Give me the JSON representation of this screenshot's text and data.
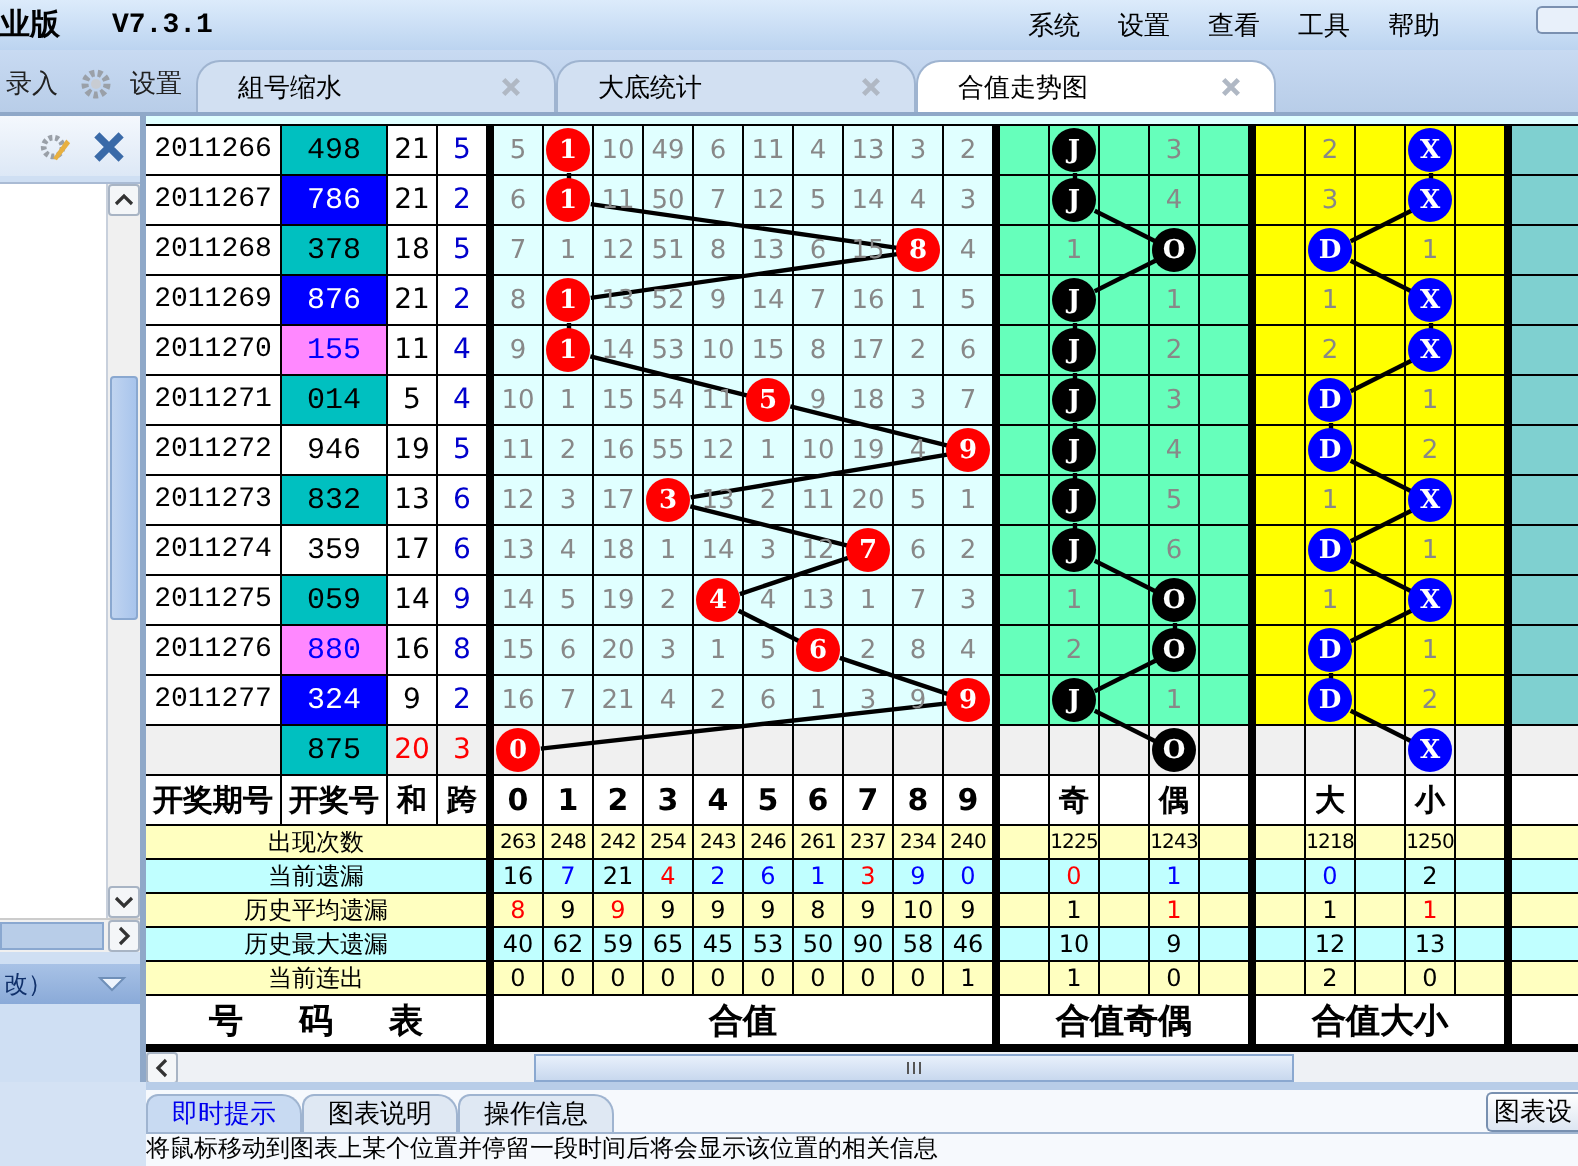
{
  "title_bar": {
    "title": "业版",
    "version": "V7.3.1",
    "menu": [
      "系统",
      "设置",
      "查看",
      "工具",
      "帮助"
    ]
  },
  "toolbar": [
    {
      "label": "录入",
      "kind": "text"
    },
    {
      "label": "设置",
      "kind": "gear"
    }
  ],
  "tabs": [
    {
      "label": "組号缩水",
      "selected": false
    },
    {
      "label": "大底统计",
      "selected": false
    },
    {
      "label": "合值走势图",
      "selected": true
    }
  ],
  "left_panel": {
    "footer_label": "改）"
  },
  "chart": {
    "rows": [
      {
        "kind": "draw",
        "period": "2011266",
        "number": "498",
        "color": "#00c0c0",
        "sum": "21",
        "span": "5",
        "sum_cells": [
          {
            "text": "5",
            "ball": false
          },
          {
            "text": "1",
            "ball": true
          },
          {
            "text": "10",
            "ball": false
          },
          {
            "text": "49",
            "ball": false
          },
          {
            "text": "6",
            "ball": false
          },
          {
            "text": "11",
            "ball": false
          },
          {
            "text": "4",
            "ball": false
          },
          {
            "text": "13",
            "ball": false
          },
          {
            "text": "3",
            "ball": false
          },
          {
            "text": "2",
            "ball": false
          }
        ],
        "parity_cells": [
          {
            "text": "J",
            "ball": true
          },
          {
            "text": "3",
            "ball": false
          }
        ],
        "size_cells": [
          {
            "text": "2",
            "ball": false
          },
          {
            "text": "X",
            "ball": true
          }
        ]
      },
      {
        "kind": "draw",
        "period": "2011267",
        "number": "786",
        "color": "#0000ff",
        "sum": "21",
        "span": "2",
        "sum_cells": [
          {
            "text": "6",
            "ball": false
          },
          {
            "text": "1",
            "ball": true
          },
          {
            "text": "11",
            "ball": false
          },
          {
            "text": "50",
            "ball": false
          },
          {
            "text": "7",
            "ball": false
          },
          {
            "text": "12",
            "ball": false
          },
          {
            "text": "5",
            "ball": false
          },
          {
            "text": "14",
            "ball": false
          },
          {
            "text": "4",
            "ball": false
          },
          {
            "text": "3",
            "ball": false
          }
        ],
        "parity_cells": [
          {
            "text": "J",
            "ball": true
          },
          {
            "text": "4",
            "ball": false
          }
        ],
        "size_cells": [
          {
            "text": "3",
            "ball": false
          },
          {
            "text": "X",
            "ball": true
          }
        ]
      },
      {
        "kind": "draw",
        "period": "2011268",
        "number": "378",
        "color": "#00c0c0",
        "sum": "18",
        "span": "5",
        "sum_cells": [
          {
            "text": "7",
            "ball": false
          },
          {
            "text": "1",
            "ball": false
          },
          {
            "text": "12",
            "ball": false
          },
          {
            "text": "51",
            "ball": false
          },
          {
            "text": "8",
            "ball": false
          },
          {
            "text": "13",
            "ball": false
          },
          {
            "text": "6",
            "ball": false
          },
          {
            "text": "15",
            "ball": false
          },
          {
            "text": "8",
            "ball": true
          },
          {
            "text": "4",
            "ball": false
          }
        ],
        "parity_cells": [
          {
            "text": "1",
            "ball": false
          },
          {
            "text": "O",
            "ball": true
          }
        ],
        "size_cells": [
          {
            "text": "D",
            "ball": true
          },
          {
            "text": "1",
            "ball": false
          }
        ]
      },
      {
        "kind": "draw",
        "period": "2011269",
        "number": "876",
        "color": "#0000ff",
        "sum": "21",
        "span": "2",
        "sum_cells": [
          {
            "text": "8",
            "ball": false
          },
          {
            "text": "1",
            "ball": true
          },
          {
            "text": "13",
            "ball": false
          },
          {
            "text": "52",
            "ball": false
          },
          {
            "text": "9",
            "ball": false
          },
          {
            "text": "14",
            "ball": false
          },
          {
            "text": "7",
            "ball": false
          },
          {
            "text": "16",
            "ball": false
          },
          {
            "text": "1",
            "ball": false
          },
          {
            "text": "5",
            "ball": false
          }
        ],
        "parity_cells": [
          {
            "text": "J",
            "ball": true
          },
          {
            "text": "1",
            "ball": false
          }
        ],
        "size_cells": [
          {
            "text": "1",
            "ball": false
          },
          {
            "text": "X",
            "ball": true
          }
        ]
      },
      {
        "kind": "draw",
        "period": "2011270",
        "number": "155",
        "color": "#ff88ff",
        "sum": "11",
        "span": "4",
        "sum_cells": [
          {
            "text": "9",
            "ball": false
          },
          {
            "text": "1",
            "ball": true
          },
          {
            "text": "14",
            "ball": false
          },
          {
            "text": "53",
            "ball": false
          },
          {
            "text": "10",
            "ball": false
          },
          {
            "text": "15",
            "ball": false
          },
          {
            "text": "8",
            "ball": false
          },
          {
            "text": "17",
            "ball": false
          },
          {
            "text": "2",
            "ball": false
          },
          {
            "text": "6",
            "ball": false
          }
        ],
        "parity_cells": [
          {
            "text": "J",
            "ball": true
          },
          {
            "text": "2",
            "ball": false
          }
        ],
        "size_cells": [
          {
            "text": "2",
            "ball": false
          },
          {
            "text": "X",
            "ball": true
          }
        ]
      },
      {
        "kind": "draw",
        "period": "2011271",
        "number": "014",
        "color": "#00c0c0",
        "sum": "5",
        "span": "4",
        "sum_cells": [
          {
            "text": "10",
            "ball": false
          },
          {
            "text": "1",
            "ball": false
          },
          {
            "text": "15",
            "ball": false
          },
          {
            "text": "54",
            "ball": false
          },
          {
            "text": "11",
            "ball": false
          },
          {
            "text": "5",
            "ball": true
          },
          {
            "text": "9",
            "ball": false
          },
          {
            "text": "18",
            "ball": false
          },
          {
            "text": "3",
            "ball": false
          },
          {
            "text": "7",
            "ball": false
          }
        ],
        "parity_cells": [
          {
            "text": "J",
            "ball": true
          },
          {
            "text": "3",
            "ball": false
          }
        ],
        "size_cells": [
          {
            "text": "D",
            "ball": true
          },
          {
            "text": "1",
            "ball": false
          }
        ]
      },
      {
        "kind": "draw",
        "period": "2011272",
        "number": "946",
        "color": "#ffffff",
        "sum": "19",
        "span": "5",
        "sum_cells": [
          {
            "text": "11",
            "ball": false
          },
          {
            "text": "2",
            "ball": false
          },
          {
            "text": "16",
            "ball": false
          },
          {
            "text": "55",
            "ball": false
          },
          {
            "text": "12",
            "ball": false
          },
          {
            "text": "1",
            "ball": false
          },
          {
            "text": "10",
            "ball": false
          },
          {
            "text": "19",
            "ball": false
          },
          {
            "text": "4",
            "ball": false
          },
          {
            "text": "9",
            "ball": true
          }
        ],
        "parity_cells": [
          {
            "text": "J",
            "ball": true
          },
          {
            "text": "4",
            "ball": false
          }
        ],
        "size_cells": [
          {
            "text": "D",
            "ball": true
          },
          {
            "text": "2",
            "ball": false
          }
        ]
      },
      {
        "kind": "draw",
        "period": "2011273",
        "number": "832",
        "color": "#00c0c0",
        "sum": "13",
        "span": "6",
        "sum_cells": [
          {
            "text": "12",
            "ball": false
          },
          {
            "text": "3",
            "ball": false
          },
          {
            "text": "17",
            "ball": false
          },
          {
            "text": "3",
            "ball": true
          },
          {
            "text": "13",
            "ball": false
          },
          {
            "text": "2",
            "ball": false
          },
          {
            "text": "11",
            "ball": false
          },
          {
            "text": "20",
            "ball": false
          },
          {
            "text": "5",
            "ball": false
          },
          {
            "text": "1",
            "ball": false
          }
        ],
        "parity_cells": [
          {
            "text": "J",
            "ball": true
          },
          {
            "text": "5",
            "ball": false
          }
        ],
        "size_cells": [
          {
            "text": "1",
            "ball": false
          },
          {
            "text": "X",
            "ball": true
          }
        ]
      },
      {
        "kind": "draw",
        "period": "2011274",
        "number": "359",
        "color": "#ffffff",
        "sum": "17",
        "span": "6",
        "sum_cells": [
          {
            "text": "13",
            "ball": false
          },
          {
            "text": "4",
            "ball": false
          },
          {
            "text": "18",
            "ball": false
          },
          {
            "text": "1",
            "ball": false
          },
          {
            "text": "14",
            "ball": false
          },
          {
            "text": "3",
            "ball": false
          },
          {
            "text": "12",
            "ball": false
          },
          {
            "text": "7",
            "ball": true
          },
          {
            "text": "6",
            "ball": false
          },
          {
            "text": "2",
            "ball": false
          }
        ],
        "parity_cells": [
          {
            "text": "J",
            "ball": true
          },
          {
            "text": "6",
            "ball": false
          }
        ],
        "size_cells": [
          {
            "text": "D",
            "ball": true
          },
          {
            "text": "1",
            "ball": false
          }
        ]
      },
      {
        "kind": "draw",
        "period": "2011275",
        "number": "059",
        "color": "#00c0c0",
        "sum": "14",
        "span": "9",
        "sum_cells": [
          {
            "text": "14",
            "ball": false
          },
          {
            "text": "5",
            "ball": false
          },
          {
            "text": "19",
            "ball": false
          },
          {
            "text": "2",
            "ball": false
          },
          {
            "text": "4",
            "ball": true
          },
          {
            "text": "4",
            "ball": false
          },
          {
            "text": "13",
            "ball": false
          },
          {
            "text": "1",
            "ball": false
          },
          {
            "text": "7",
            "ball": false
          },
          {
            "text": "3",
            "ball": false
          }
        ],
        "parity_cells": [
          {
            "text": "1",
            "ball": false
          },
          {
            "text": "O",
            "ball": true
          }
        ],
        "size_cells": [
          {
            "text": "1",
            "ball": false
          },
          {
            "text": "X",
            "ball": true
          }
        ]
      },
      {
        "kind": "draw",
        "period": "2011276",
        "number": "880",
        "color": "#ff88ff",
        "sum": "16",
        "span": "8",
        "sum_cells": [
          {
            "text": "15",
            "ball": false
          },
          {
            "text": "6",
            "ball": false
          },
          {
            "text": "20",
            "ball": false
          },
          {
            "text": "3",
            "ball": false
          },
          {
            "text": "1",
            "ball": false
          },
          {
            "text": "5",
            "ball": false
          },
          {
            "text": "6",
            "ball": true
          },
          {
            "text": "2",
            "ball": false
          },
          {
            "text": "8",
            "ball": false
          },
          {
            "text": "4",
            "ball": false
          }
        ],
        "parity_cells": [
          {
            "text": "2",
            "ball": false
          },
          {
            "text": "O",
            "ball": true
          }
        ],
        "size_cells": [
          {
            "text": "D",
            "ball": true
          },
          {
            "text": "1",
            "ball": false
          }
        ]
      },
      {
        "kind": "draw",
        "period": "2011277",
        "number": "324",
        "color": "#0000ff",
        "sum": "9",
        "span": "2",
        "sum_cells": [
          {
            "text": "16",
            "ball": false
          },
          {
            "text": "7",
            "ball": false
          },
          {
            "text": "21",
            "ball": false
          },
          {
            "text": "4",
            "ball": false
          },
          {
            "text": "2",
            "ball": false
          },
          {
            "text": "6",
            "ball": false
          },
          {
            "text": "1",
            "ball": false
          },
          {
            "text": "3",
            "ball": false
          },
          {
            "text": "9",
            "ball": false
          },
          {
            "text": "9",
            "ball": true
          }
        ],
        "parity_cells": [
          {
            "text": "J",
            "ball": true
          },
          {
            "text": "1",
            "ball": false
          }
        ],
        "size_cells": [
          {
            "text": "D",
            "ball": true
          },
          {
            "text": "2",
            "ball": false
          }
        ]
      },
      {
        "kind": "forecast",
        "number": "875",
        "color": "#00c0c0",
        "sum": "20",
        "span": "3",
        "sum_cells": [
          {
            "text": "0",
            "ball": true
          },
          {
            "ball": false
          },
          {
            "ball": false
          },
          {
            "ball": false
          },
          {
            "ball": false
          },
          {
            "ball": false
          },
          {
            "ball": false
          },
          {
            "ball": false
          },
          {
            "ball": false
          },
          {
            "ball": false
          }
        ],
        "parity_cells": [
          {
            "ball": false
          },
          {
            "text": "O",
            "ball": true
          }
        ],
        "size_cells": [
          {
            "ball": false
          },
          {
            "text": "X",
            "ball": true
          }
        ]
      }
    ],
    "header": {
      "columns": [
        "开奖期号",
        "开奖号",
        "和",
        "跨"
      ],
      "digits": [
        "0",
        "1",
        "2",
        "3",
        "4",
        "5",
        "6",
        "7",
        "8",
        "9"
      ],
      "parity": [
        "奇",
        "偶"
      ],
      "size": [
        "大",
        "小"
      ]
    },
    "stats": [
      {
        "label": "出现次数",
        "values": [
          {
            "text": "263"
          },
          {
            "text": "248"
          },
          {
            "text": "242"
          },
          {
            "text": "254"
          },
          {
            "text": "243"
          },
          {
            "text": "246"
          },
          {
            "text": "261"
          },
          {
            "text": "237"
          },
          {
            "text": "234"
          },
          {
            "text": "240"
          }
        ],
        "parity": [
          {
            "text": "1225"
          },
          {
            "text": "1243"
          }
        ],
        "size": [
          {
            "text": "1218"
          },
          {
            "text": "1250"
          }
        ]
      },
      {
        "label": "当前遗漏",
        "values": [
          {
            "text": "16"
          },
          {
            "text": "7",
            "color": "#0000ff"
          },
          {
            "text": "21"
          },
          {
            "text": "4",
            "color": "#ff0000"
          },
          {
            "text": "2",
            "color": "#0000ff"
          },
          {
            "text": "6",
            "color": "#0000ff"
          },
          {
            "text": "1",
            "color": "#0000ff"
          },
          {
            "text": "3",
            "color": "#ff0000"
          },
          {
            "text": "9",
            "color": "#0000ff"
          },
          {
            "text": "0",
            "color": "#0000ff"
          }
        ],
        "parity": [
          {
            "text": "0",
            "color": "#ff0000"
          },
          {
            "text": "1",
            "color": "#0000ff"
          }
        ],
        "size": [
          {
            "text": "0",
            "color": "#0000ff"
          },
          {
            "text": "2"
          }
        ]
      },
      {
        "label": "历史平均遗漏",
        "values": [
          {
            "text": "8",
            "color": "#ff0000"
          },
          {
            "text": "9"
          },
          {
            "text": "9",
            "color": "#ff0000"
          },
          {
            "text": "9"
          },
          {
            "text": "9"
          },
          {
            "text": "9"
          },
          {
            "text": "8"
          },
          {
            "text": "9"
          },
          {
            "text": "10"
          },
          {
            "text": "9"
          }
        ],
        "parity": [
          {
            "text": "1"
          },
          {
            "text": "1",
            "color": "#ff0000"
          }
        ],
        "size": [
          {
            "text": "1"
          },
          {
            "text": "1",
            "color": "#ff0000"
          }
        ]
      },
      {
        "label": "历史最大遗漏",
        "values": [
          {
            "text": "40"
          },
          {
            "text": "62"
          },
          {
            "text": "59"
          },
          {
            "text": "65"
          },
          {
            "text": "45"
          },
          {
            "text": "53"
          },
          {
            "text": "50"
          },
          {
            "text": "90"
          },
          {
            "text": "58"
          },
          {
            "text": "46"
          }
        ],
        "parity": [
          {
            "text": "10"
          },
          {
            "text": "9"
          }
        ],
        "size": [
          {
            "text": "12"
          },
          {
            "text": "13"
          }
        ]
      },
      {
        "label": "当前连出",
        "values": [
          {
            "text": "0"
          },
          {
            "text": "0"
          },
          {
            "text": "0"
          },
          {
            "text": "0"
          },
          {
            "text": "0"
          },
          {
            "text": "0"
          },
          {
            "text": "0"
          },
          {
            "text": "0"
          },
          {
            "text": "0"
          },
          {
            "text": "1"
          }
        ],
        "parity": [
          {
            "text": "1"
          },
          {
            "text": "0"
          }
        ],
        "size": [
          {
            "text": "2"
          },
          {
            "text": "0"
          }
        ]
      }
    ],
    "footer": [
      "号 码 表",
      "合值",
      "合值奇偶",
      "合值大小"
    ]
  },
  "bottom_panel": {
    "tabs": [
      {
        "label": "即时提示",
        "selected": true
      },
      {
        "label": "图表说明",
        "selected": false
      },
      {
        "label": "操作信息",
        "selected": false
      }
    ],
    "hint": "将鼠标移动到图表上某个位置并停留一段时间后将会显示该位置的相关信息",
    "button": "图表设"
  }
}
